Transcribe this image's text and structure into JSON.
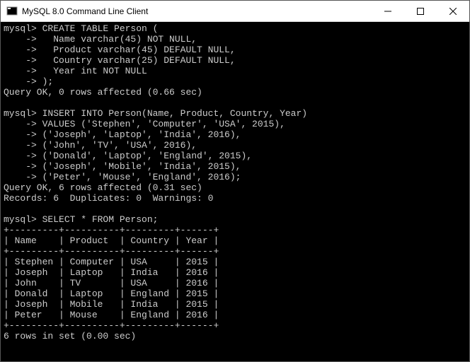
{
  "window": {
    "title": "MySQL 8.0 Command Line Client"
  },
  "terminal": {
    "content": "mysql> CREATE TABLE Person (\n    ->   Name varchar(45) NOT NULL,\n    ->   Product varchar(45) DEFAULT NULL,\n    ->   Country varchar(25) DEFAULT NULL,\n    ->   Year int NOT NULL\n    -> );\nQuery OK, 0 rows affected (0.66 sec)\n\nmysql> INSERT INTO Person(Name, Product, Country, Year)\n    -> VALUES ('Stephen', 'Computer', 'USA', 2015),\n    -> ('Joseph', 'Laptop', 'India', 2016),\n    -> ('John', 'TV', 'USA', 2016),\n    -> ('Donald', 'Laptop', 'England', 2015),\n    -> ('Joseph', 'Mobile', 'India', 2015),\n    -> ('Peter', 'Mouse', 'England', 2016);\nQuery OK, 6 rows affected (0.31 sec)\nRecords: 6  Duplicates: 0  Warnings: 0\n\nmysql> SELECT * FROM Person;\n+---------+----------+---------+------+\n| Name    | Product  | Country | Year |\n+---------+----------+---------+------+\n| Stephen | Computer | USA     | 2015 |\n| Joseph  | Laptop   | India   | 2016 |\n| John    | TV       | USA     | 2016 |\n| Donald  | Laptop   | England | 2015 |\n| Joseph  | Mobile   | India   | 2015 |\n| Peter   | Mouse    | England | 2016 |\n+---------+----------+---------+------+\n6 rows in set (0.00 sec)"
  }
}
